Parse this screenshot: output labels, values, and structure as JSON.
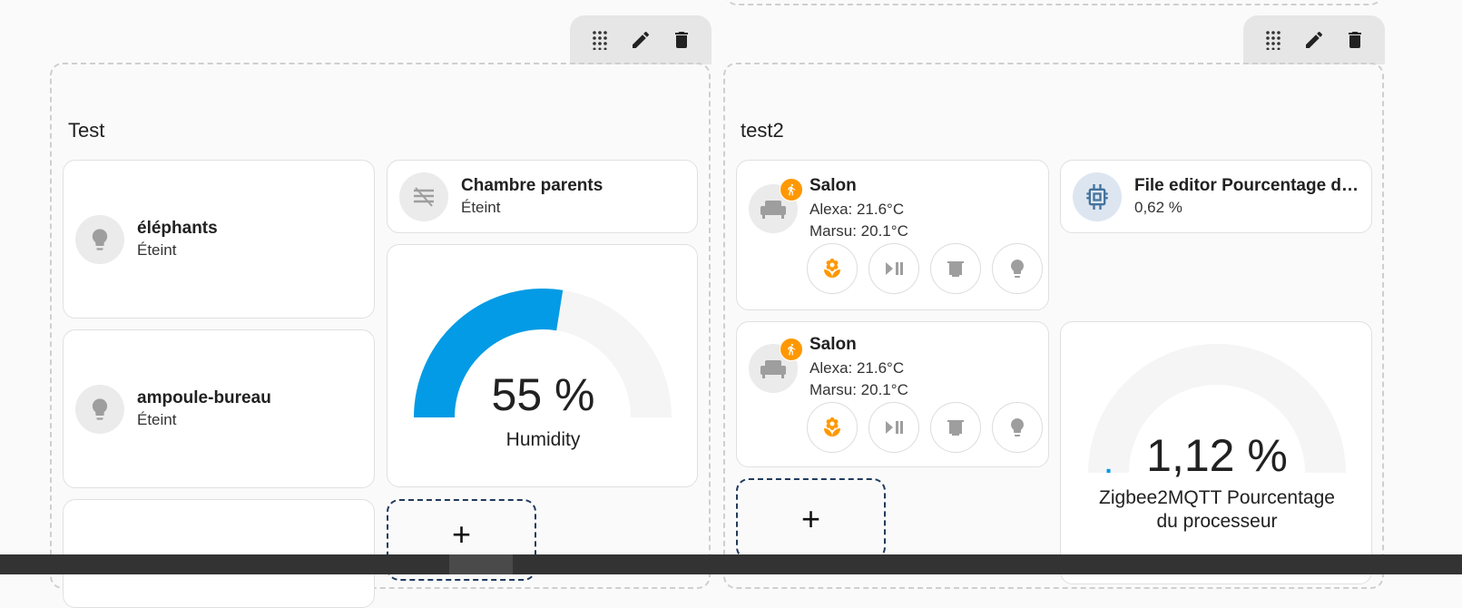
{
  "sections": [
    {
      "title": "Test",
      "toolbar": {
        "move_icon": "drag-handle-icon",
        "edit_icon": "pencil-icon",
        "delete_icon": "trash-icon"
      },
      "tiles": [
        {
          "name": "éléphants",
          "state": "Éteint",
          "icon": "lightbulb-icon"
        },
        {
          "name": "ampoule-bureau",
          "state": "Éteint",
          "icon": "lightbulb-icon"
        },
        {
          "name": "Chambre parents",
          "state": "Éteint",
          "icon": "blinds-icon"
        }
      ],
      "gauge": {
        "value": "55 %",
        "name": "Humidity",
        "level": 0.55,
        "color": "#039be5"
      },
      "add_label": "+"
    },
    {
      "title": "test2",
      "toolbar": {
        "move_icon": "drag-handle-icon",
        "edit_icon": "pencil-icon",
        "delete_icon": "trash-icon"
      },
      "areas": [
        {
          "name": "Salon",
          "line1": "Alexa: 21.6°C",
          "line2": "Marsu: 20.1°C",
          "icon": "sofa-icon",
          "badge_icon": "motion-icon"
        },
        {
          "name": "Salon",
          "line1": "Alexa: 21.6°C",
          "line2": "Marsu: 20.1°C",
          "icon": "sofa-icon",
          "badge_icon": "motion-icon"
        }
      ],
      "area_buttons": [
        "flower-icon",
        "play-pause-icon",
        "blinds-icon",
        "lightbulb-icon"
      ],
      "tile": {
        "name": "File editor Pourcentage d…",
        "state": "0,62 %",
        "icon": "chip-icon"
      },
      "gauge": {
        "value": "1,12 %",
        "name_line1": "Zigbee2MQTT Pourcentage",
        "name_line2": "du processeur",
        "level": 0.0112,
        "color": "#039be5"
      },
      "add_label": "+"
    }
  ],
  "colors": {
    "accent": "#ff9800",
    "gauge_fill": "#039be5",
    "gauge_track": "#f5f5f5",
    "chip_bg": "#dde6f0",
    "chip_fg": "#44739e"
  }
}
